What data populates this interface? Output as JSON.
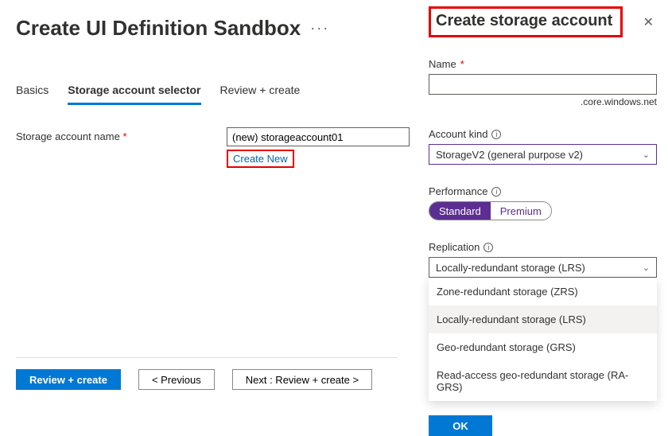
{
  "page": {
    "title": "Create UI Definition Sandbox",
    "more_glyph": "···"
  },
  "tabs": {
    "basics": "Basics",
    "selector": "Storage account selector",
    "review": "Review + create"
  },
  "main": {
    "storage_label": "Storage account name",
    "storage_value": "(new) storageaccount01",
    "create_new": "Create New"
  },
  "footer": {
    "review": "Review + create",
    "previous": "< Previous",
    "next": "Next : Review + create >"
  },
  "flyout": {
    "title": "Create storage account",
    "name_label": "Name",
    "name_suffix": ".core.windows.net",
    "kind_label": "Account kind",
    "kind_value": "StorageV2 (general purpose v2)",
    "perf_label": "Performance",
    "perf_standard": "Standard",
    "perf_premium": "Premium",
    "repl_label": "Replication",
    "repl_value": "Locally-redundant storage (LRS)",
    "repl_options": {
      "zrs": "Zone-redundant storage (ZRS)",
      "lrs": "Locally-redundant storage (LRS)",
      "grs": "Geo-redundant storage (GRS)",
      "ragrs": "Read-access geo-redundant storage (RA-GRS)"
    },
    "ok": "OK"
  }
}
